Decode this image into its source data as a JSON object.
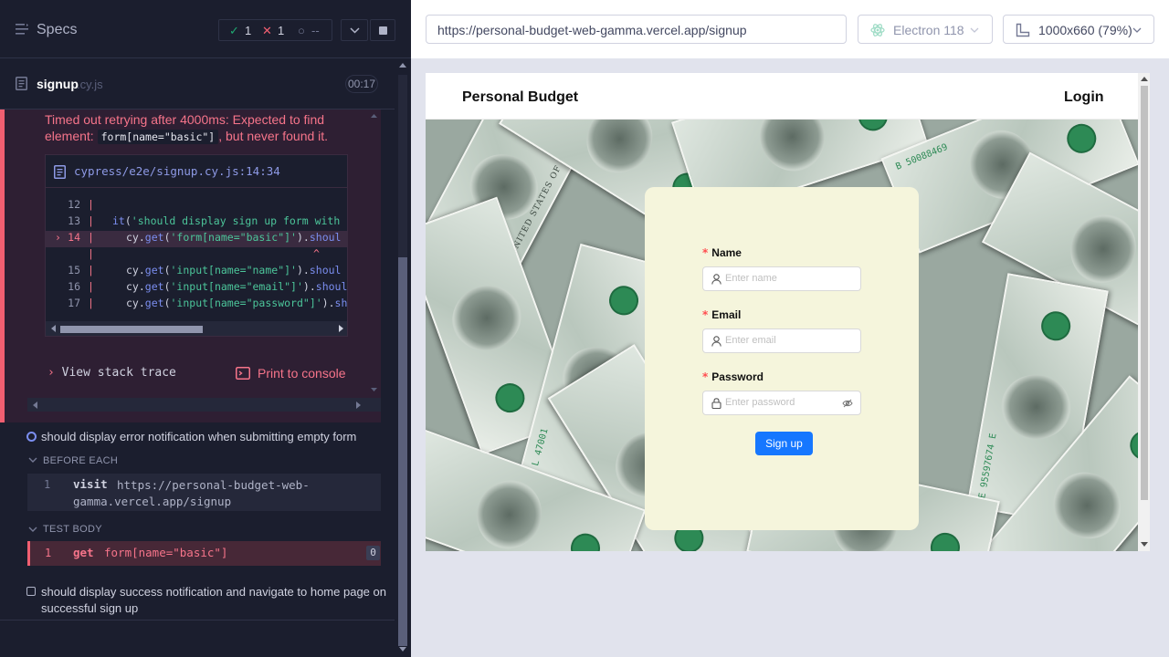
{
  "runner": {
    "specs_label": "Specs",
    "stats": {
      "passed": "1",
      "failed": "1",
      "pending": "--"
    },
    "spec": {
      "name": "signup",
      "ext": ".cy.js",
      "duration": "00:17"
    }
  },
  "error": {
    "message_pre": "Timed out retrying after 4000ms: Expected to find element:",
    "selector": "form[name=\"basic\"]",
    "message_post": ", but never found it.",
    "file_path": "cypress/e2e/signup.cy.js:14:34",
    "code_lines": [
      {
        "num": "12",
        "text": ""
      },
      {
        "num": "13",
        "text": "it('should display sign up form with"
      },
      {
        "num": "14",
        "text": "cy.get('form[name=\"basic\"]').shoul"
      },
      {
        "num": "",
        "text": "^"
      },
      {
        "num": "15",
        "text": "cy.get('input[name=\"name\"]').shoul"
      },
      {
        "num": "16",
        "text": "cy.get('input[name=\"email\"]').shoul"
      },
      {
        "num": "17",
        "text": "cy.get('input[name=\"password\"]').sh"
      }
    ],
    "view_stack_trace": "View stack trace",
    "print_to_console": "Print to console"
  },
  "tests": {
    "test2_title": "should display error notification when submitting empty form",
    "before_each_label": "BEFORE EACH",
    "before_each_cmd": {
      "num": "1",
      "name": "visit",
      "arg": "https://personal-budget-web-gamma.vercel.app/signup"
    },
    "test_body_label": "TEST BODY",
    "test_body_cmd": {
      "num": "1",
      "name": "get",
      "arg": "form[name=\"basic\"]",
      "count": "0"
    },
    "test3_title": "should display success notification and navigate to home page on successful sign up"
  },
  "aut": {
    "url": "https://personal-budget-web-gamma.vercel.app/signup",
    "browser": "Electron 118",
    "viewport": "1000x660",
    "viewport_display": "1000x660  (79%)"
  },
  "app": {
    "brand": "Personal Budget",
    "login": "Login",
    "fields": [
      {
        "label": "Name",
        "placeholder": "Enter name"
      },
      {
        "label": "Email",
        "placeholder": "Enter email"
      },
      {
        "label": "Password",
        "placeholder": "Enter password"
      }
    ],
    "submit_label": "Sign up",
    "bill_texts": {
      "serial_a": "L 47001",
      "serial_b": "E 95597674 E",
      "serial_c": "B 50088469",
      "label": "THE UNITED STATES OF AMERICA"
    }
  },
  "colors": {
    "fail": "#f15f71",
    "pass": "#1fa971",
    "card_bg": "#f5f5dc",
    "primary_button": "#1677ff"
  }
}
